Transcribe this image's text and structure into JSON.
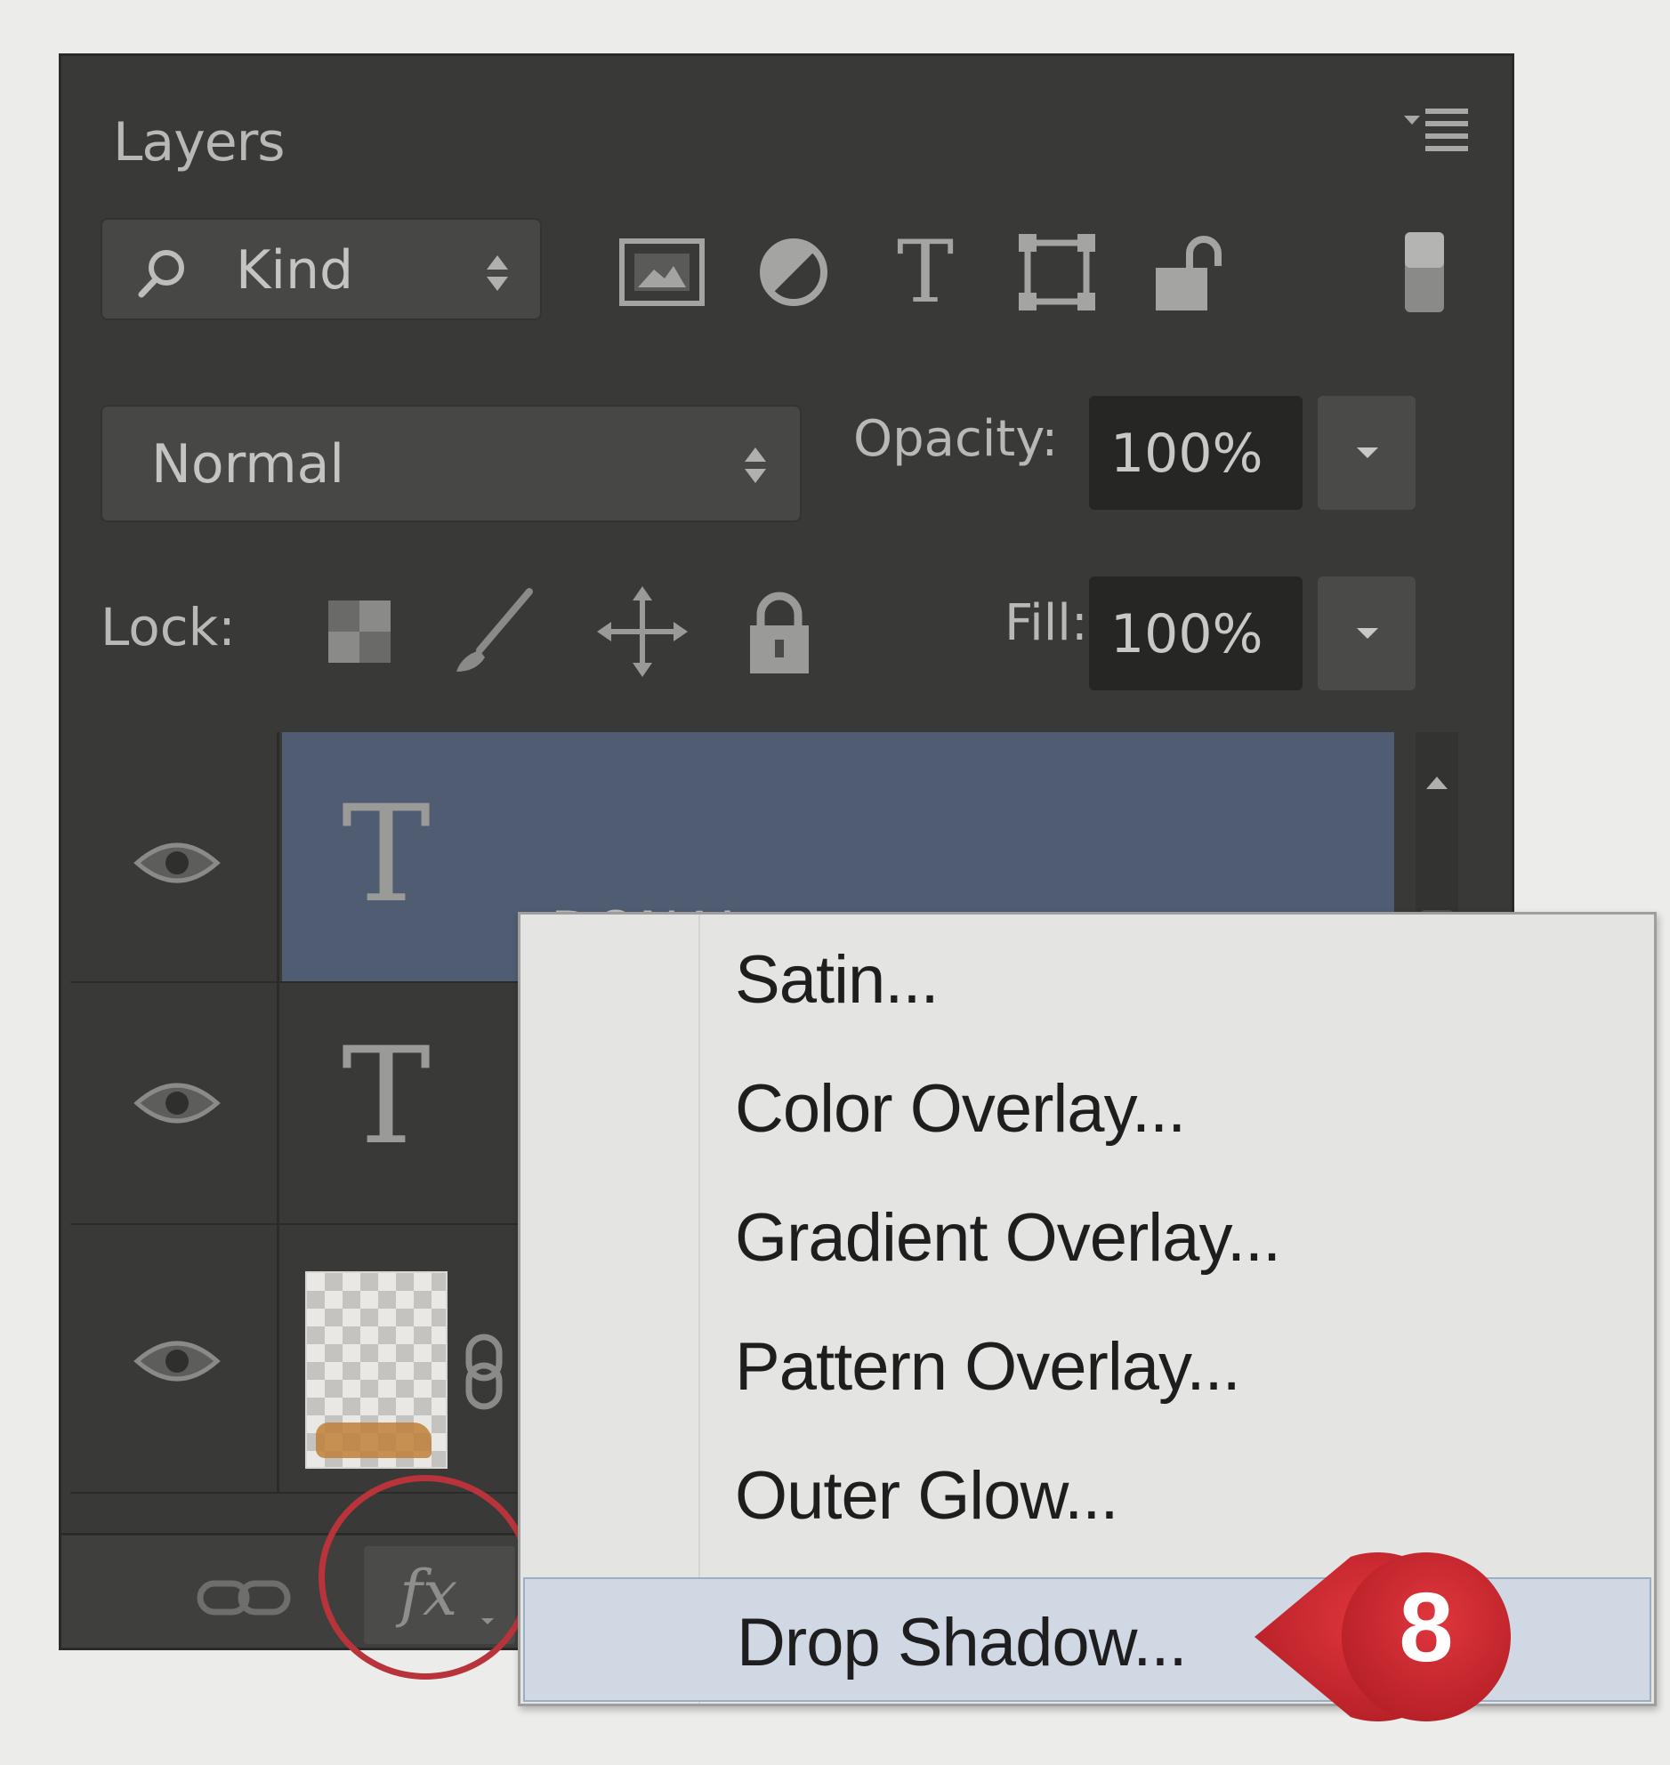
{
  "panel": {
    "title": "Layers",
    "filter": {
      "kind_label": "Kind"
    },
    "blend_mode": "Normal",
    "opacity_label": "Opacity:",
    "opacity_value": "100%",
    "lock_label": "Lock:",
    "fill_label": "Fill:",
    "fill_value": "100%"
  },
  "layers": [
    {
      "name": "DONAL",
      "type": "text",
      "selected": true,
      "visible": true
    },
    {
      "name": "",
      "type": "text",
      "selected": false,
      "visible": true
    },
    {
      "name": "",
      "type": "image",
      "selected": false,
      "visible": true
    }
  ],
  "fx_menu": {
    "items": [
      "Satin...",
      "Color Overlay...",
      "Gradient Overlay...",
      "Pattern Overlay...",
      "Outer Glow...",
      "Drop Shadow..."
    ],
    "highlighted_item": "Drop Shadow..."
  },
  "bottom_bar": {
    "fx_label": "fx"
  },
  "step_badge": "8",
  "colors": {
    "panel_bg": "#393938",
    "selected_layer": "#4f5c72",
    "menu_bg": "#e4e4e2",
    "badge_red": "#c9252d"
  }
}
